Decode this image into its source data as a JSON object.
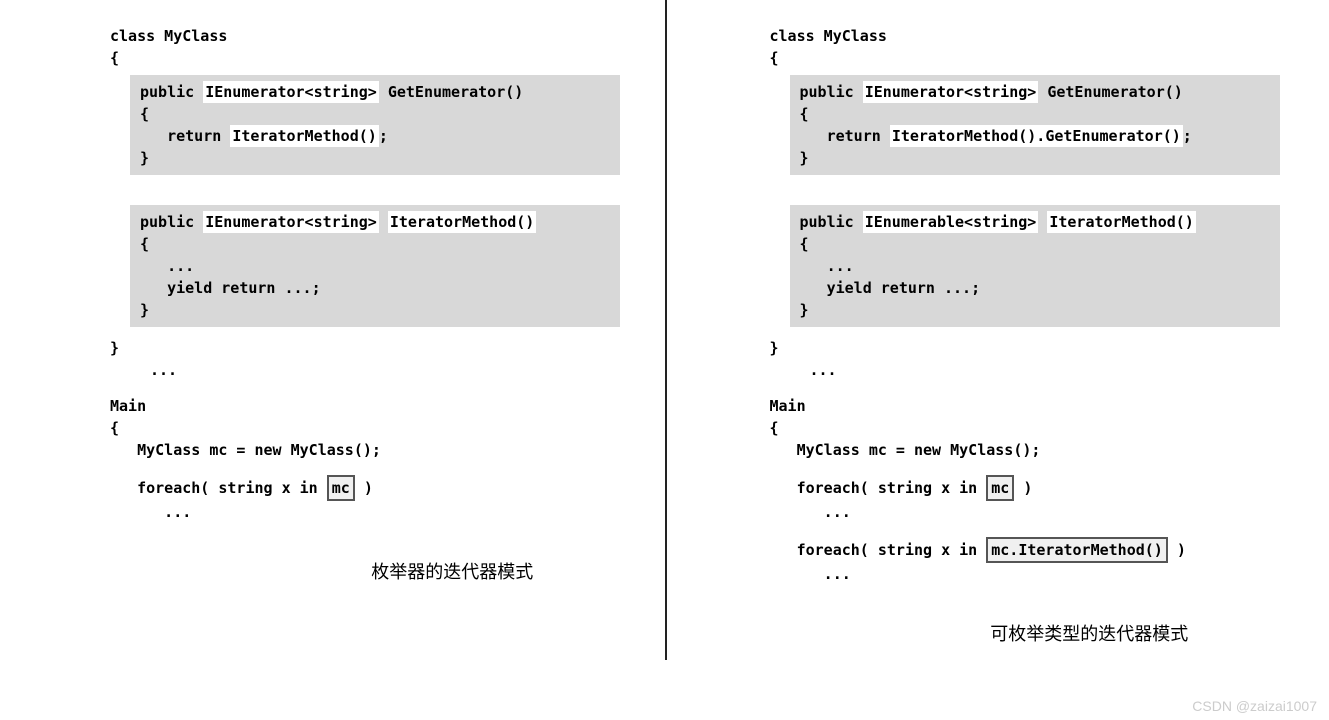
{
  "left": {
    "classDecl": "class MyClass",
    "openBrace": "{",
    "box1": {
      "sig_pre": "public ",
      "sig_hl": "IEnumerator<string>",
      "sig_post": " GetEnumerator()",
      "open": "{",
      "ret_pre": "   return ",
      "ret_hl": "IteratorMethod()",
      "ret_post": ";",
      "close": "}"
    },
    "box2": {
      "sig_pre": "public ",
      "sig_hl": "IEnumerator<string>",
      "sig_post": " ",
      "sig_hl2": "IteratorMethod()",
      "open": "{",
      "body1": "   ...",
      "body2": "   yield return ...;",
      "close": "}"
    },
    "closeBrace": "}",
    "dots1": "...",
    "main": "Main",
    "mainOpen": "{",
    "mainLine1": "   MyClass mc = new MyClass();",
    "foreach_pre": "   foreach( string x in ",
    "foreach_box": "mc",
    "foreach_post": " )",
    "mainDots": "      ...",
    "caption": "枚举器的迭代器模式"
  },
  "right": {
    "classDecl": "class MyClass",
    "openBrace": "{",
    "box1": {
      "sig_pre": "public ",
      "sig_hl": "IEnumerator<string>",
      "sig_post": " GetEnumerator()",
      "open": "{",
      "ret_pre": "   return ",
      "ret_hl": "IteratorMethod().GetEnumerator()",
      "ret_post": ";",
      "close": "}"
    },
    "box2": {
      "sig_pre": "public ",
      "sig_hl": "IEnumerable<string>",
      "sig_post": " ",
      "sig_hl2": "IteratorMethod()",
      "open": "{",
      "body1": "   ...",
      "body2": "   yield return ...;",
      "close": "}"
    },
    "closeBrace": "}",
    "dots1": "...",
    "main": "Main",
    "mainOpen": "{",
    "mainLine1": "   MyClass mc = new MyClass();",
    "foreach_pre": "   foreach( string x in ",
    "foreach_box": "mc",
    "foreach_post": " )",
    "mainDots": "      ...",
    "foreach2_pre": "   foreach( string x in ",
    "foreach2_box": "mc.IteratorMethod()",
    "foreach2_post": " )",
    "mainDots2": "      ...",
    "caption": "可枚举类型的迭代器模式"
  },
  "watermark": "CSDN @zaizai1007"
}
